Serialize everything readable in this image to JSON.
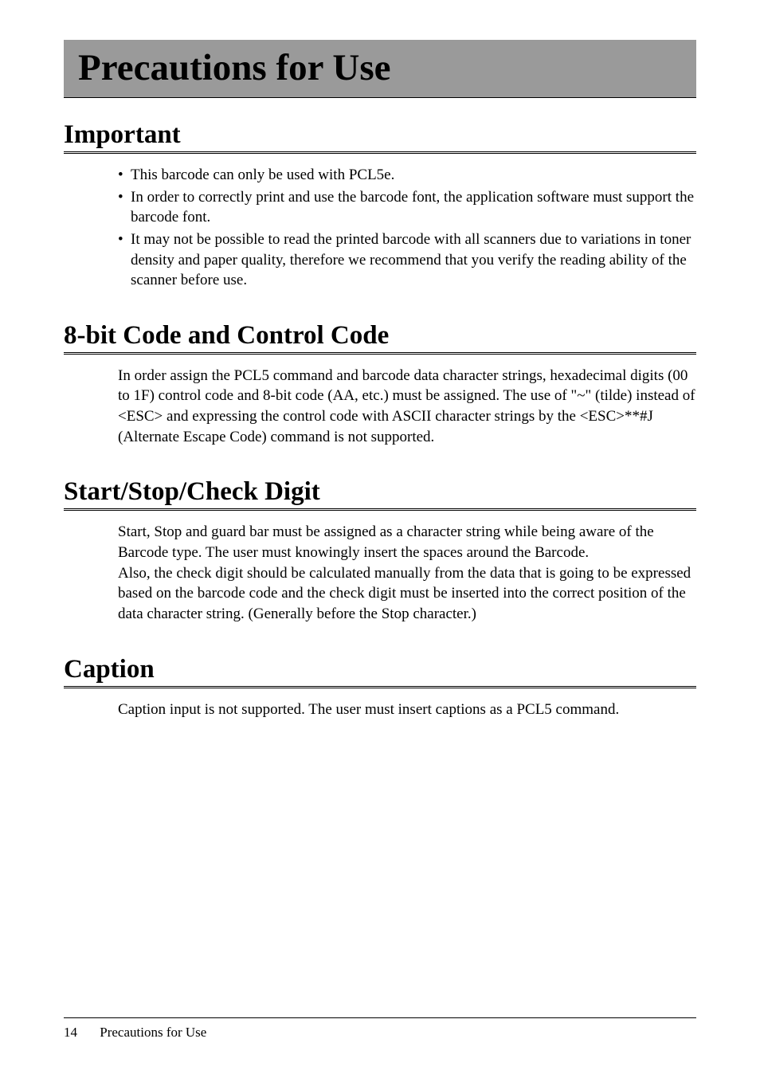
{
  "page_title": "Precautions for Use",
  "sections": {
    "important": {
      "heading": "Important",
      "bullets": [
        "This barcode can only be used with PCL5e.",
        "In order to correctly print and use the barcode font, the application software must support the barcode font.",
        "It may not be possible to read the printed barcode with all scanners due to variations in toner density and paper quality, therefore we recommend that you verify the reading ability of the scanner before use."
      ]
    },
    "eightbit": {
      "heading": "8-bit Code and Control Code",
      "body": "In order assign the PCL5 command and barcode data character strings, hexadecimal digits (00 to 1F) control code and 8-bit code (AA, etc.) must be assigned. The use of \"~\" (tilde) instead of <ESC> and expressing the control code with ASCII character strings by the <ESC>**#J (Alternate Escape Code) command is not supported."
    },
    "startstop": {
      "heading": "Start/Stop/Check Digit",
      "body": "Start, Stop and guard bar must be assigned as a character string while being aware of the Barcode type. The user must knowingly insert the spaces around the Barcode.\nAlso, the check digit should be calculated manually from the data that is going to be expressed based on the barcode code and the check digit must be inserted into the correct position of the data character string. (Generally before the Stop character.)"
    },
    "caption": {
      "heading": "Caption",
      "body": "Caption input is not supported. The user must insert captions as a PCL5 command."
    }
  },
  "footer": {
    "page_number": "14",
    "section_name": "Precautions for Use"
  }
}
